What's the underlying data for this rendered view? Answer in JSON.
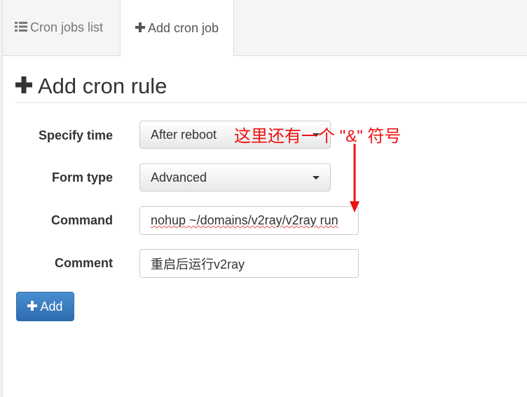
{
  "tabs": [
    {
      "label": "Cron jobs list",
      "icon": "list-icon"
    },
    {
      "label": "Add cron job",
      "icon": "plus-icon"
    }
  ],
  "page_title": "Add cron rule",
  "form": {
    "specify_time": {
      "label": "Specify time",
      "value": "After reboot"
    },
    "form_type": {
      "label": "Form type",
      "value": "Advanced"
    },
    "command": {
      "label": "Command",
      "value": "nohup ~/domains/v2ray/v2ray run"
    },
    "comment": {
      "label": "Comment",
      "value": "重启后运行v2ray"
    }
  },
  "add_button": {
    "label": "Add",
    "icon": "plus-icon"
  },
  "annotation": {
    "text": "这里还有一个 \"&\" 符号",
    "color": "#ee1111"
  },
  "colors": {
    "primary": "#337ab7",
    "annotation": "#ee1111"
  }
}
